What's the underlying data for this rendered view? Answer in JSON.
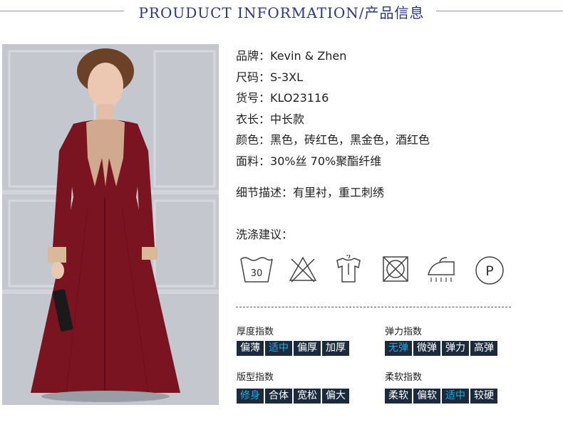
{
  "header": {
    "title": "PROUDUCT INFORMATION/产品信息"
  },
  "info": {
    "rows": [
      {
        "label": "品牌：",
        "value": "Kevin & Zhen"
      },
      {
        "label": "尺码：",
        "value": "S-3XL"
      },
      {
        "label": "货号：",
        "value": "KLO23116"
      },
      {
        "label": "衣长：",
        "value": "中长款"
      },
      {
        "label": "颜色：",
        "value": "黑色，砖红色，黑金色，酒红色"
      },
      {
        "label": "面料：",
        "value": "30%丝 70%聚酯纤维"
      }
    ],
    "detail_label": "细节描述：",
    "detail_value": "有里衬，重工刺绣",
    "care_title": "洗涤建议："
  },
  "care_icons": [
    {
      "icon": "wash-30-icon",
      "text": "30"
    },
    {
      "icon": "no-bleach-icon"
    },
    {
      "icon": "hang-dry-icon"
    },
    {
      "icon": "no-tumble-dry-icon"
    },
    {
      "icon": "iron-low-icon"
    },
    {
      "icon": "dry-clean-p-icon",
      "text": "P"
    }
  ],
  "indices": {
    "thickness": {
      "label": "厚度指数",
      "options": [
        "偏薄",
        "适中",
        "偏厚",
        "加厚"
      ],
      "selected": 1
    },
    "elasticity": {
      "label": "弹力指数",
      "options": [
        "无弹",
        "微弹",
        "弹力",
        "高弹"
      ],
      "selected": 0
    },
    "fit": {
      "label": "版型指数",
      "options": [
        "修身",
        "合体",
        "宽松",
        "偏大"
      ],
      "selected": 0
    },
    "softness": {
      "label": "柔软指数",
      "options": [
        "柔软",
        "偏软",
        "适中",
        "较硬"
      ],
      "selected": 2
    }
  },
  "colors": {
    "title": "#2b3680",
    "option_bg": "#1c2a3e",
    "option_active": "#29a8e0",
    "dress": "#7a1420"
  }
}
